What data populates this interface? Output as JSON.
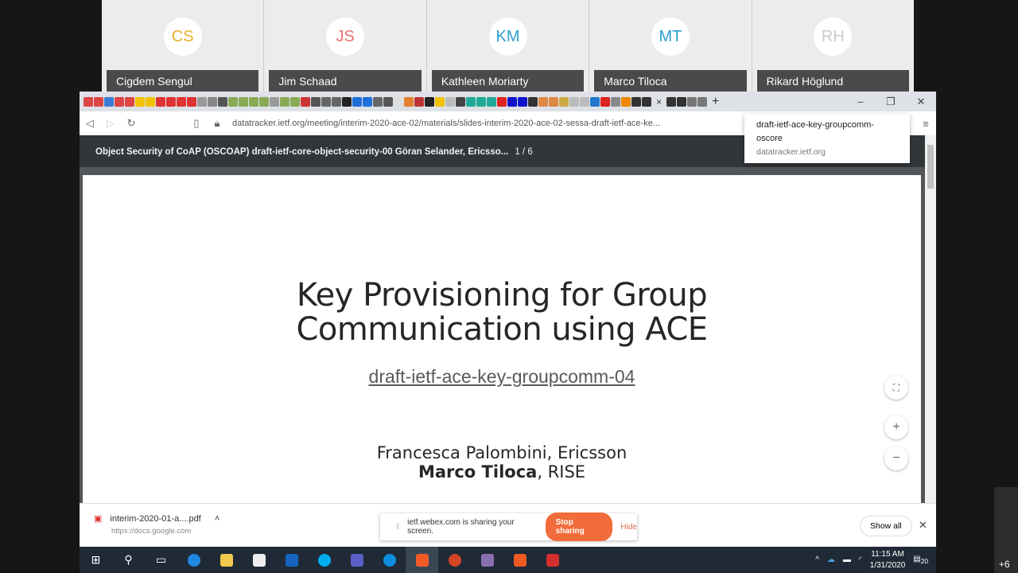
{
  "participants": [
    {
      "initials": "CS",
      "name": "Cigdem Sengul",
      "color": "#e8b030"
    },
    {
      "initials": "JS",
      "name": "Jim Schaad",
      "color": "#e86f6f"
    },
    {
      "initials": "KM",
      "name": "Kathleen Moriarty",
      "color": "#2a9fd0"
    },
    {
      "initials": "MT",
      "name": "Marco Tiloca",
      "color": "#2a9fd0"
    },
    {
      "initials": "RH",
      "name": "Rikard Höglund",
      "color": "#cccccc"
    }
  ],
  "browser": {
    "favicon_colors": [
      "#d44",
      "#d44",
      "#3a7bd5",
      "#d44",
      "#d44",
      "#f2c200",
      "#f2c200",
      "#d33",
      "#d33",
      "#d33",
      "#d33",
      "#999",
      "#888",
      "#555",
      "#8a5",
      "#8a5",
      "#8a5",
      "#8a5",
      "#999",
      "#8a5",
      "#8a5",
      "#c33",
      "#555",
      "#666",
      "#666",
      "#222",
      "#1e6fd9",
      "#1e6fd9",
      "#666",
      "#555",
      "#ddd",
      "#e08030",
      "#b33",
      "#222",
      "#f2c200",
      "#bbb",
      "#444",
      "#2a9",
      "#2a9",
      "#2a9",
      "#d22",
      "#11c",
      "#11c",
      "#333",
      "#d84",
      "#d84",
      "#ca4",
      "#bbb",
      "#bbb",
      "#27c",
      "#d22",
      "#888",
      "#e80",
      "#333",
      "#333"
    ],
    "active_tab_close": "×",
    "extra_favicon_colors": [
      "#333",
      "#333",
      "#777",
      "#777"
    ],
    "new_tab": "+",
    "url": "datatracker.ietf.org/meeting/interim-2020-ace-02/materials/slides-interim-2020-ace-02-sessa-draft-ietf-ace-ke...",
    "tooltip": {
      "title": "draft-ietf-ace-key-groupcomm-oscore",
      "domain": "datatracker.ietf.org"
    }
  },
  "pdf": {
    "title": "Object Security of CoAP (OSCOAP) draft-ietf-core-object-security-00 Göran Selander, Ericsso...",
    "page": "1 / 6",
    "slide": {
      "title_line1": "Key Provisioning for Group",
      "title_line2": "Communication using ACE",
      "link": "draft-ietf-ace-key-groupcomm-04",
      "author1": "Francesca Palombini, Ericsson",
      "author2_name": "Marco Tiloca",
      "author2_org": ", RISE"
    }
  },
  "downloads": {
    "file": "interim-2020-01-a....pdf",
    "source": "https://docs.google.com",
    "show_all": "Show all"
  },
  "share_bar": {
    "message": "ietf.webex.com is sharing your screen.",
    "stop": "Stop sharing",
    "hide": "Hide"
  },
  "taskbar": {
    "time": "11:15 AM",
    "date": "1/31/2020",
    "notifications": "20"
  },
  "side": {
    "more": "+6"
  }
}
